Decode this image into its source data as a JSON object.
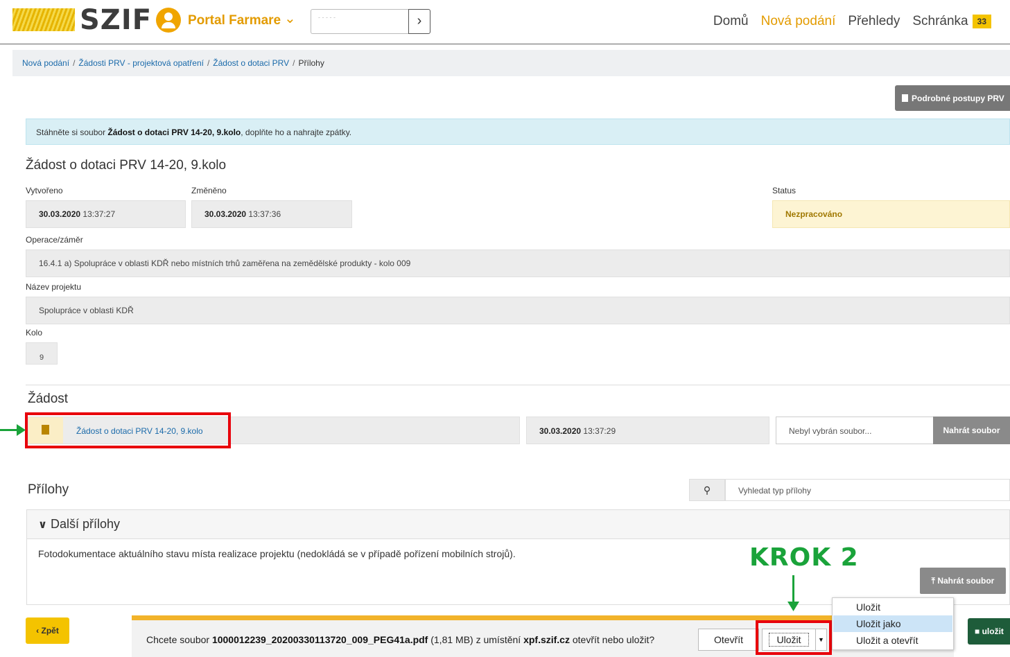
{
  "header": {
    "logo": "SZIF",
    "portal": "Portal Farmare",
    "search_value": "- - - - -",
    "nav": [
      {
        "label": "Domů"
      },
      {
        "label": "Nová podání"
      },
      {
        "label": "Přehledy"
      },
      {
        "label": "Schránka"
      }
    ],
    "inbox_count": "33",
    "accent_color": "#e39b00"
  },
  "breadcrumb": {
    "items": [
      "Nová podání",
      "Žádosti PRV - projektová opatření",
      "Žádost o dotaci PRV"
    ],
    "current": "Přílohy",
    "sep": "/"
  },
  "procedures_button": "Podrobné postupy PRV",
  "alert": {
    "before": "Stáhněte si soubor ",
    "bold": "Žádost o dotaci PRV 14-20, 9.kolo",
    "after": ", doplňte ho a nahrajte zpátky."
  },
  "form": {
    "title": "Žádost o dotaci PRV 14-20, 9.kolo",
    "created_label": "Vytvořeno",
    "created_date": "30.03.2020",
    "created_time": "13:37:27",
    "changed_label": "Změněno",
    "changed_date": "30.03.2020",
    "changed_time": "13:37:36",
    "status_label": "Status",
    "status_value": "Nezpracováno",
    "operation_label": "Operace/záměr",
    "operation_value": "16.4.1 a) Spolupráce v oblasti KDŘ nebo místních trhů zaměřena na zemědělské produkty - kolo 009",
    "project_label": "Název projektu",
    "project_value": "Spolupráce v oblasti KDŘ",
    "round_label": "Kolo",
    "round_value": "9"
  },
  "zadost": {
    "title": "Žádost",
    "file_link": "Žádost o dotaci PRV 14-20, 9.kolo",
    "date": "30.03.2020",
    "time": "13:37:29",
    "file_placeholder": "Nebyl vybrán soubor...",
    "upload_label": "Nahrát soubor"
  },
  "prilohy": {
    "title": "Přílohy",
    "search_placeholder": "Vyhledat typ přílohy",
    "panel_title": "Další přílohy",
    "panel_text": "Fotodokumentace aktuálního stavu místa realizace projektu (nedokládá se v případě pořízení mobilních strojů).",
    "upload_label": "Nahrát soubor"
  },
  "annotation": {
    "krok": "KROK 2",
    "color": "#1aa33a",
    "highlight_color": "#e8000b"
  },
  "footer": {
    "back_label": "Zpět",
    "save_label": "uložit"
  },
  "download_bar": {
    "prefix": "Chcete soubor ",
    "filename": "1000012239_20200330113720_009_PEG41a.pdf",
    "size": " (1,81 MB) z umístění ",
    "host": "xpf.szif.cz",
    "suffix": " otevřít nebo uložit?",
    "open_label": "Otevřít",
    "save_label": "Uložit"
  },
  "context_menu": {
    "items": [
      "Uložit",
      "Uložit jako",
      "Uložit a otevřít"
    ],
    "hovered_index": 1
  }
}
